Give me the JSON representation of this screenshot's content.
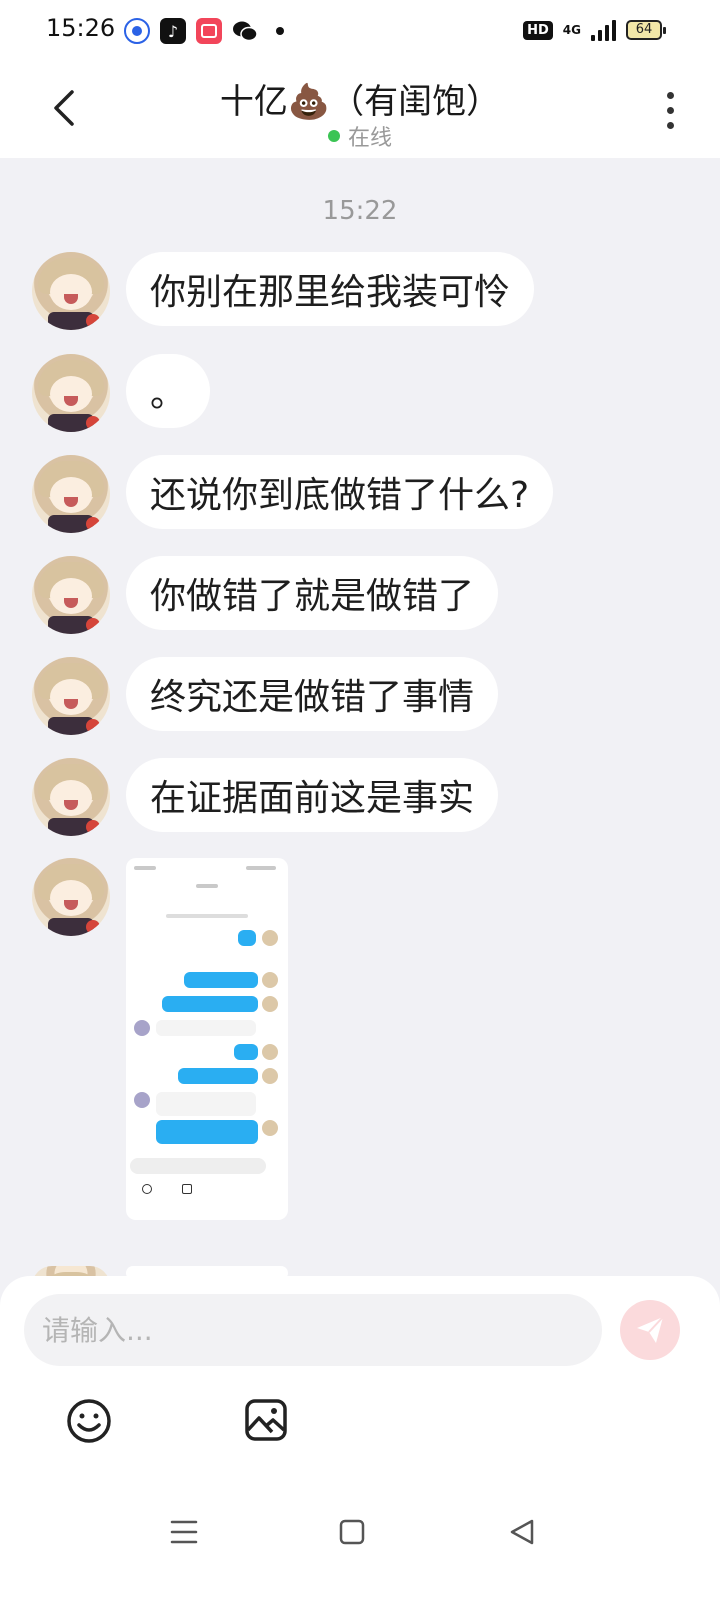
{
  "status_bar": {
    "time": "15:26",
    "app_icons": [
      "baidu-icon",
      "douyin-icon",
      "app-red-icon",
      "wechat-icon"
    ],
    "hd": "HD",
    "network": "4G",
    "battery": "64"
  },
  "header": {
    "title": "十亿💩（有闺饱）",
    "status": "在线",
    "online_color": "#3bc454"
  },
  "chat": {
    "timestamp": "15:22",
    "messages": [
      {
        "type": "text",
        "text": "你别在那里给我装可怜"
      },
      {
        "type": "text",
        "text": "。"
      },
      {
        "type": "text",
        "text": "还说你到底做错了什么?"
      },
      {
        "type": "text",
        "text": "你做错了就是做错了"
      },
      {
        "type": "text",
        "text": "终究还是做错了事情"
      },
      {
        "type": "text",
        "text": "在证据面前这是事实"
      },
      {
        "type": "image",
        "description": "screenshot-thumbnail"
      }
    ]
  },
  "composer": {
    "placeholder": "请输入...",
    "send_color": "#fbdadc"
  }
}
